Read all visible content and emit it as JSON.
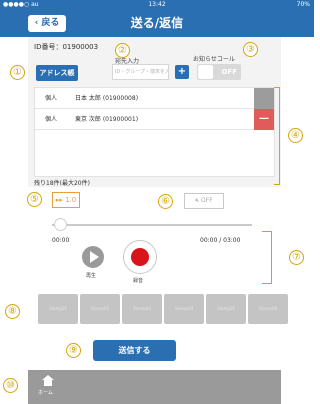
{
  "status_bar": {
    "carrier": "●●●●○ au",
    "time": "13:42",
    "battery": "70%"
  },
  "nav": {
    "back_label": "戻る",
    "title": "送る/返信"
  },
  "form": {
    "id_text": "ID番号：01900003",
    "address_book_label": "アドレス帳",
    "destination_label": "宛先入力",
    "destination_placeholder": "ID・グループ・端末を入力",
    "add_label": "+",
    "notify_label": "お知らせコール",
    "toggle_value": "OFF"
  },
  "recipients": [
    {
      "type": "個人",
      "name": "日本 太郎 (01900008)",
      "action": ""
    },
    {
      "type": "個人",
      "name": "東京 次郎 (01900001)",
      "action": "—"
    }
  ],
  "remaining_text": "残り18件(最大20件)",
  "player": {
    "speed_label": "▸▸ 1.0",
    "mute_label": "OFF",
    "elapsed": "00:00",
    "total": "00:00 / 03:00",
    "progress": 0,
    "play_label": "再生",
    "record_label": "録音"
  },
  "stamps": [
    "Stamp01",
    "Stamp02",
    "Stamp03",
    "Stamp04",
    "Stamp05",
    "Stamp06"
  ],
  "send_label": "送信する",
  "tab_bar": {
    "home_label": "ホーム"
  },
  "markers": [
    "①",
    "②",
    "③",
    "④",
    "⑤",
    "⑥",
    "⑦",
    "⑧",
    "⑨",
    "⑩"
  ],
  "colors": {
    "accent": "#2b6fb3",
    "marker": "#d4a40c",
    "record": "#d9141a",
    "delete": "#e25b5b"
  }
}
